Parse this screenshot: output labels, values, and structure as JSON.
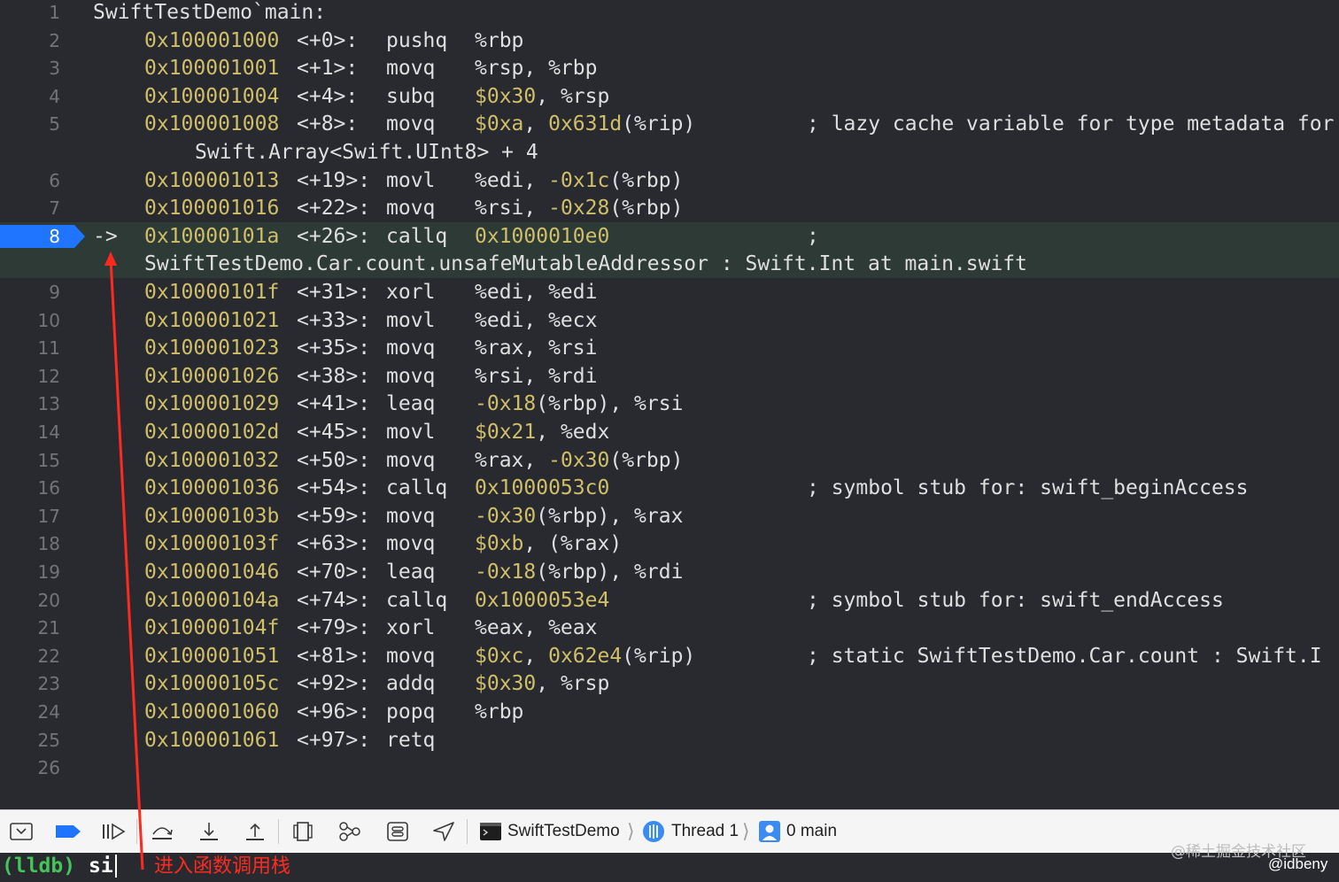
{
  "code_lines": [
    {
      "num": "1",
      "addr": "",
      "offset": "",
      "mnemonic": "",
      "operands": "SwiftTestDemo`main:",
      "comment": "",
      "cont": "",
      "current": false
    },
    {
      "num": "2",
      "addr": "0x100001000",
      "offset": "<+0>:",
      "mnemonic": "pushq",
      "operands": "%rbp",
      "comment": "",
      "cont": "",
      "current": false
    },
    {
      "num": "3",
      "addr": "0x100001001",
      "offset": "<+1>:",
      "mnemonic": "movq",
      "operands": "%rsp, %rbp",
      "comment": "",
      "cont": "",
      "current": false
    },
    {
      "num": "4",
      "addr": "0x100001004",
      "offset": "<+4>:",
      "mnemonic": "subq",
      "operands": "$0x30, %rsp",
      "comment": "",
      "cont": "",
      "current": false
    },
    {
      "num": "5",
      "addr": "0x100001008",
      "offset": "<+8>:",
      "mnemonic": "movq",
      "operands": "$0xa, 0x631d(%rip)",
      "comment": "; lazy cache variable for type metadata for",
      "cont": "Swift.Array<Swift.UInt8> + 4",
      "current": false
    },
    {
      "num": "6",
      "addr": "0x100001013",
      "offset": "<+19>:",
      "mnemonic": "movl",
      "operands": "%edi, -0x1c(%rbp)",
      "comment": "",
      "cont": "",
      "current": false
    },
    {
      "num": "7",
      "addr": "0x100001016",
      "offset": "<+22>:",
      "mnemonic": "movq",
      "operands": "%rsi, -0x28(%rbp)",
      "comment": "",
      "cont": "",
      "current": false
    },
    {
      "num": "8",
      "addr": "0x10000101a",
      "offset": "<+26>:",
      "mnemonic": "callq",
      "operands": "0x1000010e0",
      "comment": ";",
      "cont": "SwiftTestDemo.Car.count.unsafeMutableAddressor : Swift.Int at main.swift",
      "current": true
    },
    {
      "num": "9",
      "addr": "0x10000101f",
      "offset": "<+31>:",
      "mnemonic": "xorl",
      "operands": "%edi, %edi",
      "comment": "",
      "cont": "",
      "current": false
    },
    {
      "num": "10",
      "addr": "0x100001021",
      "offset": "<+33>:",
      "mnemonic": "movl",
      "operands": "%edi, %ecx",
      "comment": "",
      "cont": "",
      "current": false
    },
    {
      "num": "11",
      "addr": "0x100001023",
      "offset": "<+35>:",
      "mnemonic": "movq",
      "operands": "%rax, %rsi",
      "comment": "",
      "cont": "",
      "current": false
    },
    {
      "num": "12",
      "addr": "0x100001026",
      "offset": "<+38>:",
      "mnemonic": "movq",
      "operands": "%rsi, %rdi",
      "comment": "",
      "cont": "",
      "current": false
    },
    {
      "num": "13",
      "addr": "0x100001029",
      "offset": "<+41>:",
      "mnemonic": "leaq",
      "operands": "-0x18(%rbp), %rsi",
      "comment": "",
      "cont": "",
      "current": false
    },
    {
      "num": "14",
      "addr": "0x10000102d",
      "offset": "<+45>:",
      "mnemonic": "movl",
      "operands": "$0x21, %edx",
      "comment": "",
      "cont": "",
      "current": false
    },
    {
      "num": "15",
      "addr": "0x100001032",
      "offset": "<+50>:",
      "mnemonic": "movq",
      "operands": "%rax, -0x30(%rbp)",
      "comment": "",
      "cont": "",
      "current": false
    },
    {
      "num": "16",
      "addr": "0x100001036",
      "offset": "<+54>:",
      "mnemonic": "callq",
      "operands": "0x1000053c0",
      "comment": "; symbol stub for: swift_beginAccess",
      "cont": "",
      "current": false
    },
    {
      "num": "17",
      "addr": "0x10000103b",
      "offset": "<+59>:",
      "mnemonic": "movq",
      "operands": "-0x30(%rbp), %rax",
      "comment": "",
      "cont": "",
      "current": false
    },
    {
      "num": "18",
      "addr": "0x10000103f",
      "offset": "<+63>:",
      "mnemonic": "movq",
      "operands": "$0xb, (%rax)",
      "comment": "",
      "cont": "",
      "current": false
    },
    {
      "num": "19",
      "addr": "0x100001046",
      "offset": "<+70>:",
      "mnemonic": "leaq",
      "operands": "-0x18(%rbp), %rdi",
      "comment": "",
      "cont": "",
      "current": false
    },
    {
      "num": "20",
      "addr": "0x10000104a",
      "offset": "<+74>:",
      "mnemonic": "callq",
      "operands": "0x1000053e4",
      "comment": "; symbol stub for: swift_endAccess",
      "cont": "",
      "current": false
    },
    {
      "num": "21",
      "addr": "0x10000104f",
      "offset": "<+79>:",
      "mnemonic": "xorl",
      "operands": "%eax, %eax",
      "comment": "",
      "cont": "",
      "current": false
    },
    {
      "num": "22",
      "addr": "0x100001051",
      "offset": "<+81>:",
      "mnemonic": "movq",
      "operands": "$0xc, 0x62e4(%rip)",
      "comment": "; static SwiftTestDemo.Car.count : Swift.I",
      "cont": "",
      "current": false
    },
    {
      "num": "23",
      "addr": "0x10000105c",
      "offset": "<+92>:",
      "mnemonic": "addq",
      "operands": "$0x30, %rsp",
      "comment": "",
      "cont": "",
      "current": false
    },
    {
      "num": "24",
      "addr": "0x100001060",
      "offset": "<+96>:",
      "mnemonic": "popq",
      "operands": "%rbp",
      "comment": "",
      "cont": "",
      "current": false
    },
    {
      "num": "25",
      "addr": "0x100001061",
      "offset": "<+97>:",
      "mnemonic": "retq",
      "operands": "",
      "comment": "",
      "cont": "",
      "current": false
    },
    {
      "num": "26",
      "addr": "",
      "offset": "",
      "mnemonic": "",
      "operands": "",
      "comment": "",
      "cont": "",
      "current": false
    }
  ],
  "pc_arrow": "->",
  "colors": {
    "background": "#292a30",
    "address": "#d0bf69",
    "text": "#dfdfe0",
    "current_line_bg": "#2d3a36",
    "breakpoint": "#1f75ff",
    "prompt": "#45c45a",
    "annotation": "#ff2a1f"
  },
  "debug_bar": {
    "icons": [
      "hide-debug-area-icon",
      "breakpoints-toggle-icon",
      "continue-icon",
      "step-over-icon",
      "step-into-icon",
      "step-out-icon",
      "view-hierarchy-icon",
      "memory-graph-icon",
      "environment-overrides-icon",
      "simulate-location-icon"
    ],
    "breadcrumb": {
      "target": "SwiftTestDemo",
      "thread": "Thread 1",
      "frame": "0 main"
    }
  },
  "console": {
    "prompt": "(lldb)",
    "command": "si"
  },
  "annotation": {
    "text": "进入函数调用栈"
  },
  "watermark": {
    "site": "@稀土掘金技术社区",
    "author": "@idbeny"
  }
}
